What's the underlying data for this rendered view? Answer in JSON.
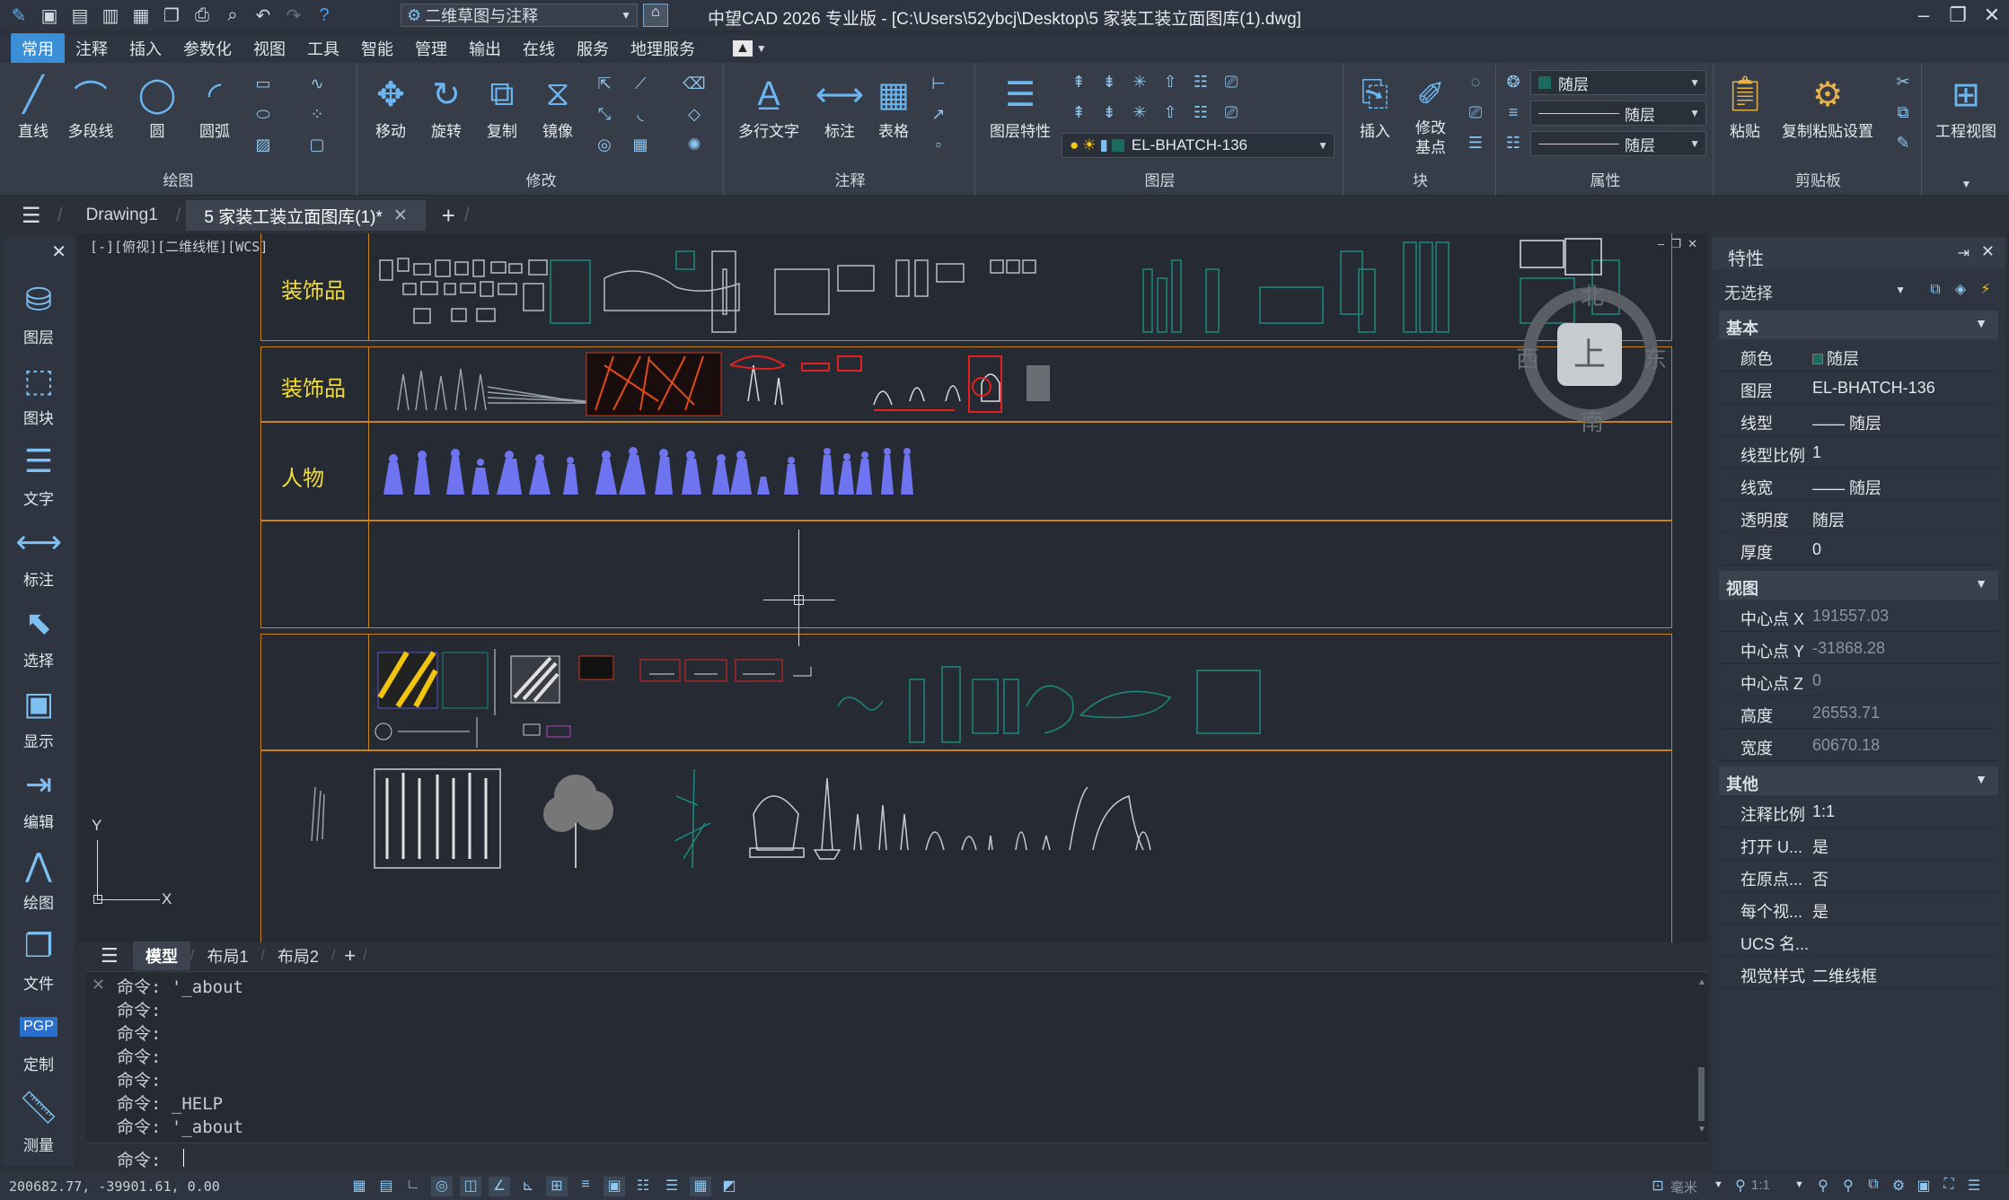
{
  "titlebar": {
    "workspace": "二维草图与注释",
    "title": "中望CAD 2026 专业版 - [C:\\Users\\52ybcj\\Desktop\\5 家装工装立面图库(1).dwg]"
  },
  "menu": [
    "常用",
    "注释",
    "插入",
    "参数化",
    "视图",
    "工具",
    "智能",
    "管理",
    "输出",
    "在线",
    "服务",
    "地理服务"
  ],
  "ribbon": {
    "draw": {
      "label": "绘图",
      "buttons": [
        "直线",
        "多段线",
        "圆",
        "圆弧"
      ]
    },
    "modify": {
      "label": "修改",
      "buttons": [
        "移动",
        "旋转",
        "复制",
        "镜像"
      ]
    },
    "annotate": {
      "label": "注释",
      "buttons": [
        "多行文字",
        "标注",
        "表格"
      ]
    },
    "layer": {
      "label": "图层",
      "button": "图层特性",
      "current_layer": "EL-BHATCH-136"
    },
    "block": {
      "label": "块",
      "buttons": [
        "插入",
        "修改基点"
      ]
    },
    "properties": {
      "label": "属性",
      "color": "随层",
      "linetype": "随层",
      "lineweight": "随层"
    },
    "clipboard": {
      "label": "剪贴板",
      "buttons": [
        "粘贴",
        "复制粘贴设置"
      ]
    },
    "view": {
      "button": "工程视图"
    }
  },
  "doc_tabs": [
    "Drawing1",
    "5 家装工装立面图库(1)*"
  ],
  "left_tools": [
    "图层",
    "图块",
    "文字",
    "标注",
    "选择",
    "显示",
    "编辑",
    "绘图",
    "文件",
    "定制",
    "测量"
  ],
  "left_tools_pgp": "PGP",
  "viewport": {
    "label": "[-][俯视][二维线框][WCS]",
    "rows": [
      "装饰品",
      "装饰品",
      "人物"
    ],
    "navcube": {
      "top": "上",
      "north": "北",
      "south": "南",
      "east": "东",
      "west": "西"
    },
    "axis_x": "X",
    "axis_y": "Y"
  },
  "layout_tabs": [
    "模型",
    "布局1",
    "布局2"
  ],
  "command_lines": [
    "命令: '_about",
    "命令:",
    "命令:",
    "命令:",
    "命令:",
    "命令: _HELP",
    "命令: '_about"
  ],
  "command_prompt": "命令:",
  "status": {
    "coords": "200682.77, -39901.61, 0.00",
    "units": "毫米",
    "scale": "1:1"
  },
  "properties_panel": {
    "title": "特性",
    "selection": "无选择",
    "sections": [
      {
        "name": "基本",
        "rows": [
          {
            "key": "颜色",
            "value": "随层"
          },
          {
            "key": "图层",
            "value": "EL-BHATCH-136"
          },
          {
            "key": "线型",
            "value": "—— 随层"
          },
          {
            "key": "线型比例",
            "value": "1"
          },
          {
            "key": "线宽",
            "value": "—— 随层"
          },
          {
            "key": "透明度",
            "value": "随层"
          },
          {
            "key": "厚度",
            "value": "0"
          }
        ]
      },
      {
        "name": "视图",
        "rows": [
          {
            "key": "中心点 X",
            "value": "191557.03"
          },
          {
            "key": "中心点 Y",
            "value": "-31868.28"
          },
          {
            "key": "中心点 Z",
            "value": "0"
          },
          {
            "key": "高度",
            "value": "26553.71"
          },
          {
            "key": "宽度",
            "value": "60670.18"
          }
        ]
      },
      {
        "name": "其他",
        "rows": [
          {
            "key": "注释比例",
            "value": "1:1"
          },
          {
            "key": "打开 U...",
            "value": "是"
          },
          {
            "key": "在原点...",
            "value": "否"
          },
          {
            "key": "每个视...",
            "value": "是"
          },
          {
            "key": "UCS 名...",
            "value": ""
          },
          {
            "key": "视觉样式",
            "value": "二维线框"
          }
        ]
      }
    ]
  },
  "colors": {
    "accent": "#3b8fd6",
    "frame": "#c8821e",
    "label_yellow": "#f2dc3a",
    "teal": "#1b8a7e",
    "people_blue": "#6e74f0"
  }
}
